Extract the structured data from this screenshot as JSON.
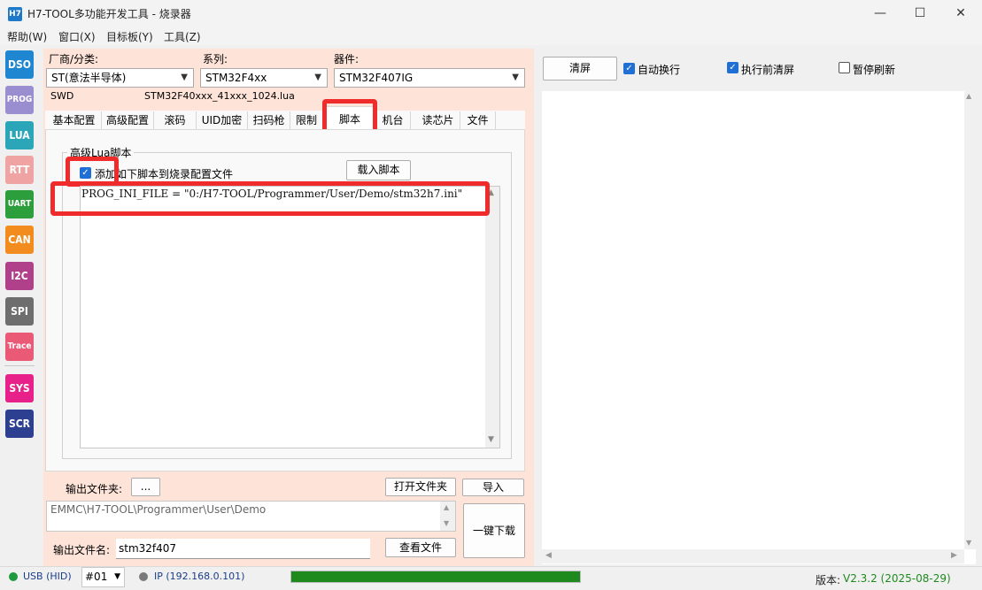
{
  "window": {
    "icon_text": "H7",
    "title": "H7-TOOL多功能开发工具 - 烧录器",
    "minimize": "—",
    "maximize": "☐",
    "close": "✕"
  },
  "menu": [
    "帮助(W)",
    "窗口(X)",
    "目标板(Y)",
    "工具(Z)"
  ],
  "sidebar": [
    {
      "label": "DSO",
      "color": "#1f86d2"
    },
    {
      "label": "PROG",
      "color": "#9a8ed0"
    },
    {
      "label": "LUA",
      "color": "#2aa6b8"
    },
    {
      "label": "RTT",
      "color": "#f0a3a3"
    },
    {
      "label": "UART",
      "color": "#2c9e3c"
    },
    {
      "label": "CAN",
      "color": "#f28c1e"
    },
    {
      "label": "I2C",
      "color": "#b0408a"
    },
    {
      "label": "SPI",
      "color": "#6e6e6e"
    },
    {
      "label": "Trace",
      "color": "#ea5a77"
    },
    {
      "label": "SYS",
      "color": "#e8208a"
    },
    {
      "label": "SCR",
      "color": "#2c3f90"
    }
  ],
  "device": {
    "vendor_label": "厂商/分类:",
    "vendor_value": "ST(意法半导体)",
    "series_label": "系列:",
    "series_value": "STM32F4xx",
    "part_label": "器件:",
    "part_value": "STM32F407IG",
    "interface": "SWD",
    "lua_file": "STM32F40xxx_41xxx_1024.lua"
  },
  "tabs": [
    "基本配置",
    "高级配置",
    "滚码",
    "UID加密",
    "扫码枪",
    "限制",
    "脚本",
    "机台",
    "读芯片",
    "文件"
  ],
  "active_tab": "脚本",
  "script_tab": {
    "group_title": "高级Lua脚本",
    "checkbox_label": "添加如下脚本到烧录配置文件",
    "checked": true,
    "load_button": "载入脚本",
    "script_text": "PROG_INI_FILE = \"0:/H7-TOOL/Programmer/User/Demo/stm32h7.ini\""
  },
  "output": {
    "folder_label": "输出文件夹:",
    "browse_button": "...",
    "open_folder_button": "打开文件夹",
    "import_button": "导入",
    "folder_path": "EMMC\\H7-TOOL\\Programmer\\User\\Demo",
    "download_button": "一键下载",
    "filename_label": "输出文件名:",
    "filename_value": "stm32f407",
    "view_file_button": "查看文件"
  },
  "right_panel": {
    "clear_button": "清屏",
    "auto_wrap_label": "自动换行",
    "auto_wrap_checked": true,
    "clear_before_label": "执行前清屏",
    "clear_before_checked": true,
    "pause_refresh_label": "暂停刷新",
    "pause_refresh_checked": false
  },
  "status": {
    "usb_label": "USB (HID)",
    "usb_color": "#1f9a3c",
    "device_select": "#01",
    "ip_label": "IP (192.168.0.101)",
    "ip_color": "#7a7a7a",
    "progress_fraction": 1.0,
    "progress_color": "#1e8a1e",
    "version_label": "版本:",
    "version_value": "V2.3.2 (2025-08-29)",
    "version_color": "#1e8a1e"
  }
}
